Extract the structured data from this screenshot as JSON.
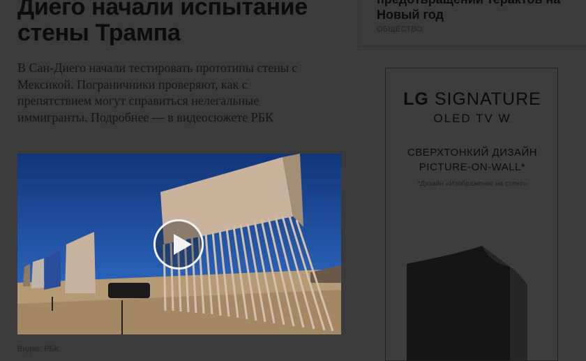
{
  "article": {
    "headline": "Диего начали испытание стены Трампа",
    "lede": "В Сан-Диего начали тестировать прототипы стены с Мексикой. Пограничники проверяют, как с препятствием могут справиться нелегальные иммигранты. Подробнее — в видеосюжете РБК",
    "video_caption": "Видео: РБК",
    "play_icon": "play-icon"
  },
  "sidebar": {
    "related_title": "предотвращении терактов на Новый год",
    "related_tag": "ОБЩЕСТВО"
  },
  "ad": {
    "brand_lg": "LG",
    "brand_rest": "SIGNATURE",
    "subbrand": "OLED TV W",
    "headline_line1": "СВЕРХТОНКИЙ ДИЗАЙН",
    "headline_line2": "PICTURE-ON-WALL*",
    "note": "*Дизайн «Изображение на стене»"
  }
}
